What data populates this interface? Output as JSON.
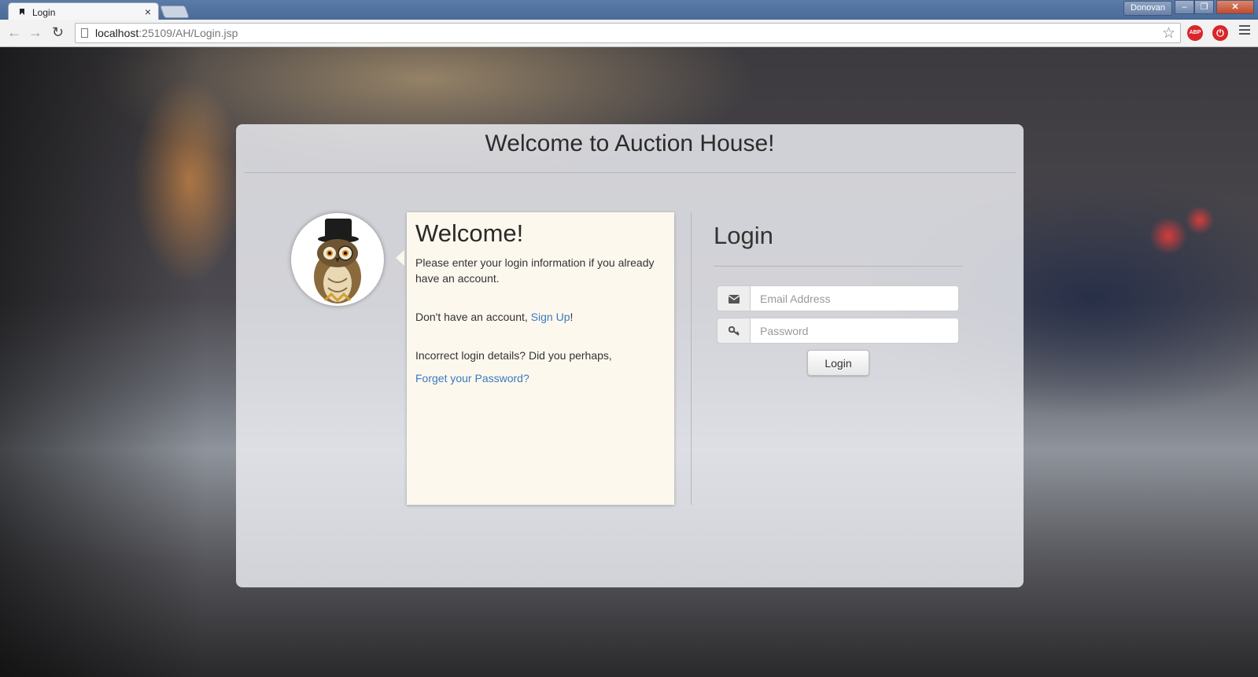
{
  "browser": {
    "tab_title": "Login",
    "tab_close": "×",
    "profile_name": "Donovan",
    "window_buttons": {
      "minimize": "–",
      "restore": "❐",
      "close": "✕"
    },
    "nav": {
      "back": "←",
      "forward": "→",
      "reload": "↻"
    },
    "url_host": "localhost",
    "url_rest": ":25109/AH/Login.jsp",
    "bookmark_star": "☆",
    "extensions": [
      {
        "name": "adblock-plus",
        "label": "ABP",
        "color": "#d8262a"
      },
      {
        "name": "power-button",
        "label": "⏻",
        "color": "#d8262a"
      }
    ]
  },
  "page": {
    "heading": "Welcome to Auction House!",
    "welcome_card": {
      "title": "Welcome!",
      "intro": "Please enter your login information if you already have an account.",
      "signup_prefix": "Don't have an account, ",
      "signup_link": "Sign Up",
      "signup_suffix": "!",
      "incorrect_text": "Incorrect login details? Did you perhaps,",
      "forgot_link": "Forget your Password?"
    },
    "login": {
      "title": "Login",
      "email": {
        "icon": "envelope-icon",
        "placeholder": "Email Address",
        "value": ""
      },
      "password": {
        "icon": "key-icon",
        "placeholder": "Password",
        "value": ""
      },
      "button_label": "Login"
    }
  },
  "colors": {
    "link": "#3a7abf",
    "card_background": "#fcf8ee",
    "panel_background": "#ecedf2"
  }
}
